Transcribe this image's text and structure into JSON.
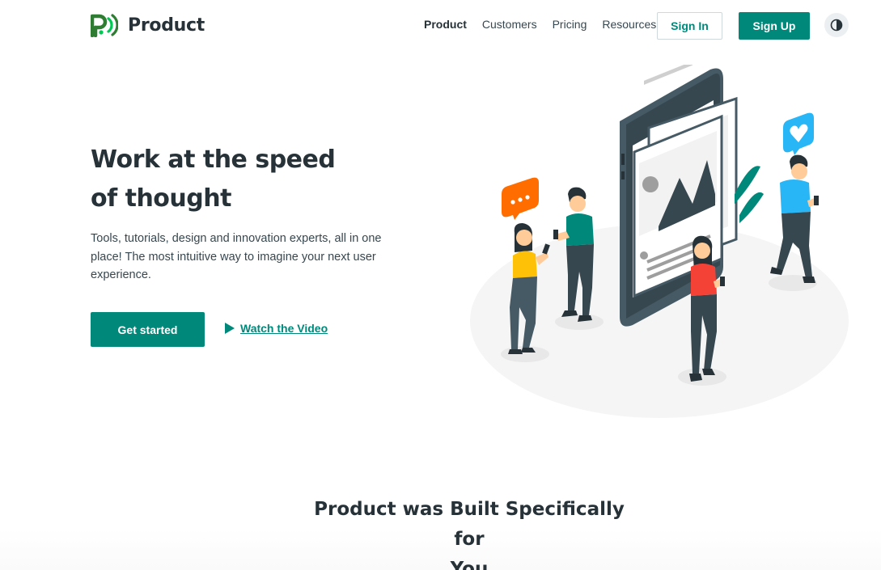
{
  "brand": {
    "name": "Product",
    "logo_icon": "product-logo-icon",
    "accent_color": "#00897b",
    "logo_colors": [
      "#1b5e20",
      "#00c853"
    ]
  },
  "nav": {
    "items": [
      {
        "label": "Product",
        "active": true
      },
      {
        "label": "Customers",
        "active": false
      },
      {
        "label": "Pricing",
        "active": false
      },
      {
        "label": "Resources",
        "active": false
      }
    ],
    "sign_in_label": "Sign In",
    "sign_up_label": "Sign Up",
    "theme_toggle_icon": "contrast-icon"
  },
  "hero": {
    "title_line1": "Work at the speed",
    "title_line2": "of thought",
    "description": "Tools, tutorials, design and innovation experts, all in one place! The most intuitive way to imagine your next user experience.",
    "cta_label": "Get started",
    "video_label": "Watch the Video",
    "video_icon": "play-icon",
    "illustration": "people-using-phones-illustration"
  },
  "section2": {
    "title_line1": "Product was Built Specifically for",
    "title_line2": "You"
  }
}
